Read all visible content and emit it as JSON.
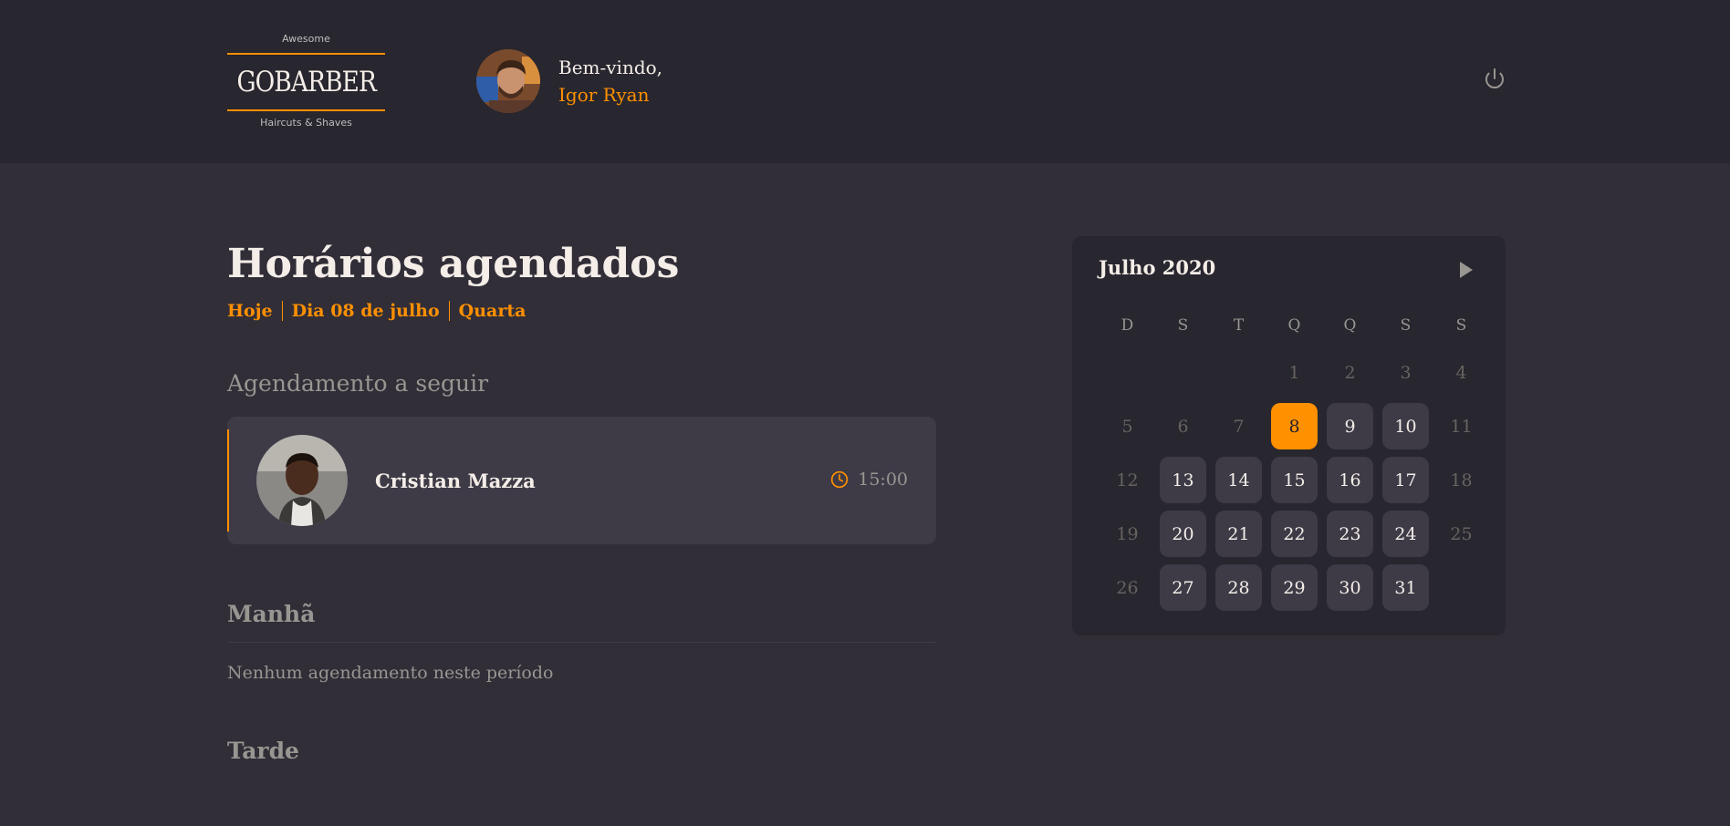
{
  "header": {
    "logo_top": "Awesome",
    "logo_brand": "GOBARBER",
    "logo_bottom": "Haircuts & Shaves",
    "welcome": "Bem-vindo,",
    "user_name": "Igor Ryan"
  },
  "main": {
    "title": "Horários agendados",
    "subtitle": [
      "Hoje",
      "Dia 08 de julho",
      "Quarta"
    ],
    "next_title": "Agendamento a seguir",
    "next": {
      "client": "Cristian Mazza",
      "time": "15:00"
    },
    "morning_title": "Manhã",
    "morning_empty": "Nenhum agendamento neste período",
    "afternoon_title": "Tarde"
  },
  "calendar": {
    "month": "Julho 2020",
    "weekdays": [
      "D",
      "S",
      "T",
      "Q",
      "Q",
      "S",
      "S"
    ],
    "weeks": [
      [
        {
          "d": ""
        },
        {
          "d": ""
        },
        {
          "d": ""
        },
        {
          "d": "1",
          "s": "disabled"
        },
        {
          "d": "2",
          "s": "disabled"
        },
        {
          "d": "3",
          "s": "disabled"
        },
        {
          "d": "4",
          "s": "disabled"
        }
      ],
      [
        {
          "d": "5",
          "s": "disabled"
        },
        {
          "d": "6",
          "s": "disabled"
        },
        {
          "d": "7",
          "s": "disabled"
        },
        {
          "d": "8",
          "s": "selected"
        },
        {
          "d": "9",
          "s": "available"
        },
        {
          "d": "10",
          "s": "available"
        },
        {
          "d": "11",
          "s": "disabled"
        }
      ],
      [
        {
          "d": "12",
          "s": "disabled"
        },
        {
          "d": "13",
          "s": "available"
        },
        {
          "d": "14",
          "s": "available"
        },
        {
          "d": "15",
          "s": "available"
        },
        {
          "d": "16",
          "s": "available"
        },
        {
          "d": "17",
          "s": "available"
        },
        {
          "d": "18",
          "s": "disabled"
        }
      ],
      [
        {
          "d": "19",
          "s": "disabled"
        },
        {
          "d": "20",
          "s": "available"
        },
        {
          "d": "21",
          "s": "available"
        },
        {
          "d": "22",
          "s": "available"
        },
        {
          "d": "23",
          "s": "available"
        },
        {
          "d": "24",
          "s": "available"
        },
        {
          "d": "25",
          "s": "disabled"
        }
      ],
      [
        {
          "d": "26",
          "s": "disabled"
        },
        {
          "d": "27",
          "s": "available"
        },
        {
          "d": "28",
          "s": "available"
        },
        {
          "d": "29",
          "s": "available"
        },
        {
          "d": "30",
          "s": "available"
        },
        {
          "d": "31",
          "s": "available"
        },
        {
          "d": ""
        }
      ]
    ]
  },
  "colors": {
    "accent": "#ff9000",
    "background": "#312e38",
    "header_bg": "#28262e",
    "card_bg": "#3e3b47"
  },
  "icons": [
    "power-icon",
    "clock-icon",
    "arrow-right-icon"
  ]
}
